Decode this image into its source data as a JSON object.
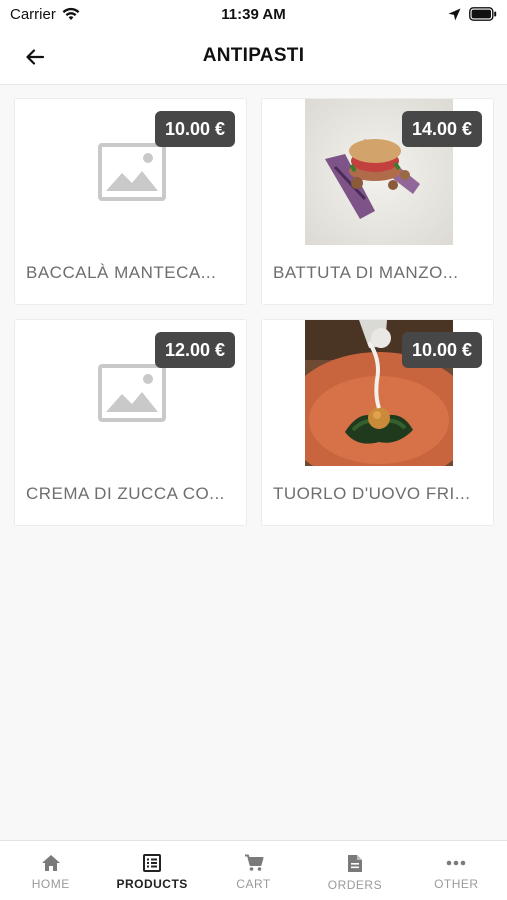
{
  "status_bar": {
    "carrier": "Carrier",
    "time": "11:39 AM"
  },
  "header": {
    "title": "ANTIPASTI"
  },
  "products": [
    {
      "name": "BACCALÀ MANTECA...",
      "price": "10.00 €",
      "image": "placeholder"
    },
    {
      "name": "BATTUTA DI MANZO...",
      "price": "14.00 €",
      "image": "photo"
    },
    {
      "name": "CREMA DI ZUCCA CO...",
      "price": "12.00 €",
      "image": "placeholder"
    },
    {
      "name": "TUORLO D'UOVO FRI...",
      "price": "10.00 €",
      "image": "photo"
    }
  ],
  "tabbar": {
    "active": "PRODUCTS",
    "items": [
      {
        "label": "HOME",
        "icon": "home-icon"
      },
      {
        "label": "PRODUCTS",
        "icon": "list-icon"
      },
      {
        "label": "CART",
        "icon": "cart-icon"
      },
      {
        "label": "ORDERS",
        "icon": "document-icon"
      },
      {
        "label": "OTHER",
        "icon": "more-icon"
      }
    ]
  },
  "colors": {
    "price_badge_bg": "#474747",
    "active_tab": "#222222",
    "inactive_tab": "#9a9a9a"
  }
}
